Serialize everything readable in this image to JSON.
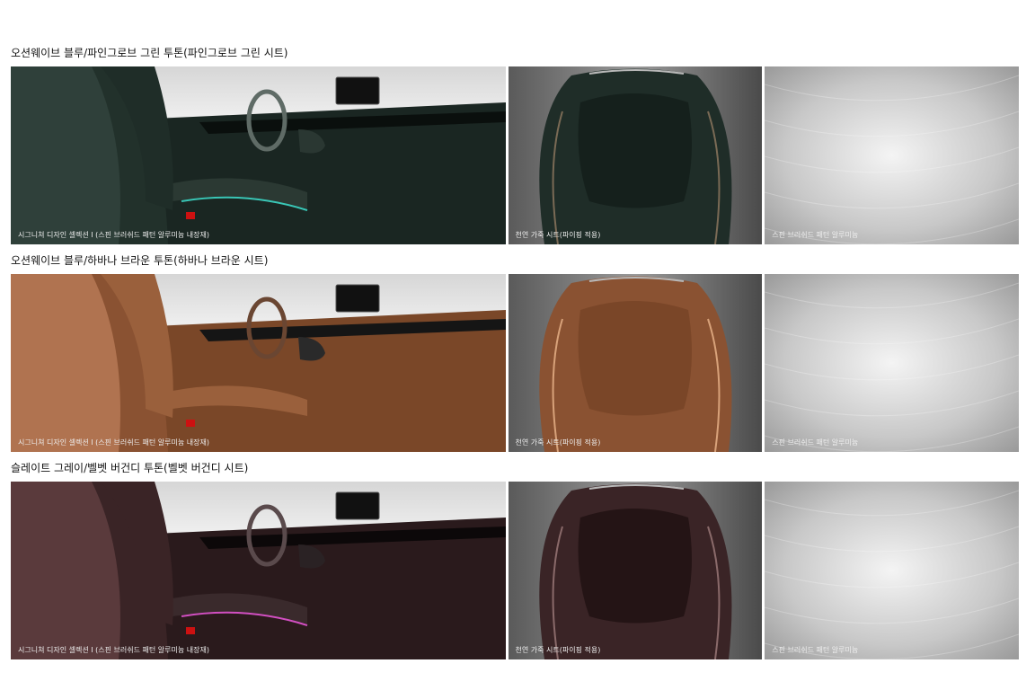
{
  "sections": [
    {
      "title": "오션웨이브 블루/파인그로브 그린 투톤(파인그로브 그린 시트)",
      "captions": [
        "시그니쳐 디자인 셀렉션 I (스핀 브러쉬드 패턴 알루미늄 내장재)",
        "천연 가죽 시트(파이핑 적용)",
        "스핀 브러쉬드 패턴 알루미늄"
      ],
      "colors": {
        "base": "#1f2d28",
        "light": "#3c4c45",
        "dark": "#0d1512",
        "accent": "#39c6b6"
      }
    },
    {
      "title": "오션웨이브 블루/하바나 브라운 투톤(하바나 브라운 시트)",
      "captions": [
        "시그니쳐 디자인 셀렉션 I (스핀 브러쉬드 패턴 알루미늄 내장재)",
        "천연 가죽 시트(파이핑 적용)",
        "스핀 브러쉬드 패턴 알루미늄"
      ],
      "colors": {
        "base": "#8a5232",
        "light": "#b07350",
        "dark": "#4a2a18",
        "accent": "#d8a27a"
      }
    },
    {
      "title": "슬레이트 그레이/벨벳 버건디 투톤(벨벳 버건디 시트)",
      "captions": [
        "시그니쳐 디자인 셀렉션 I (스핀 브러쉬드 패턴 알루미늄 내장재)",
        "천연 가죽 시트(파이핑 적용)",
        "스핀 브러쉬드 패턴 알루미늄"
      ],
      "colors": {
        "base": "#3a2426",
        "light": "#5a3a3c",
        "dark": "#1b1011",
        "accent": "#d14fc1"
      }
    }
  ]
}
